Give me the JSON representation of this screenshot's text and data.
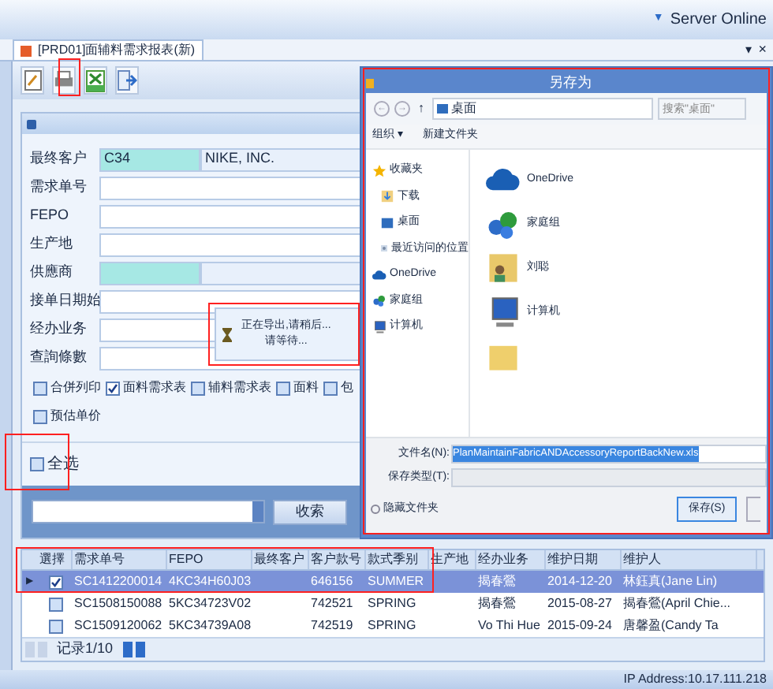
{
  "top_bar": {
    "menu_arrow": "▼",
    "status": "Server Online"
  },
  "tab": {
    "label": "[PRD01]面辅料需求报表(新)",
    "pin": "▾",
    "close": "×"
  },
  "toolbar": [
    {
      "kind": "edit"
    },
    {
      "kind": "print"
    },
    {
      "kind": "excel"
    },
    {
      "kind": "exit"
    }
  ],
  "form": {
    "fields": [
      {
        "label": "最终客户",
        "kind": "lookup",
        "value": "C34",
        "value_2": "NIKE, INC."
      },
      {
        "label": "需求单号",
        "kind": "text"
      },
      {
        "label": "FEPO",
        "kind": "text"
      },
      {
        "label": "生产地",
        "kind": "text"
      },
      {
        "label": "供應商",
        "kind": "lookup"
      },
      {
        "label": "接单日期始",
        "kind": "text"
      },
      {
        "label": "经办业务",
        "kind": "text"
      },
      {
        "label": "查詢條數",
        "kind": "text"
      }
    ],
    "checkboxes": [
      {
        "label": "合併列印",
        "checked": false
      },
      {
        "label": "面料需求表",
        "checked": true
      },
      {
        "label": "辅料需求表",
        "checked": false
      },
      {
        "label": "面料",
        "checked": false
      },
      {
        "label": "包",
        "checked": false
      },
      {
        "label": "预估单价",
        "checked": false
      }
    ],
    "select_all": {
      "label": "全选",
      "checked": false
    }
  },
  "search": {
    "button": "收索"
  },
  "grid": {
    "row_pointer": "▶",
    "check_header": "選擇",
    "columns": [
      "需求单号",
      "FEPO",
      "最终客户",
      "客户款号",
      "款式季别",
      "生产地",
      "经办业务",
      "维护日期",
      "维护人"
    ],
    "rows": [
      {
        "selected": true,
        "checked": true,
        "cells": [
          "SC1412200014",
          "4KC34H60J03",
          "",
          "646156",
          "SUMMER",
          "",
          "揭春鶯",
          "2014-12-20",
          "林鈺真(Jane Lin)"
        ]
      },
      {
        "selected": false,
        "checked": false,
        "cells": [
          "SC1508150088",
          "5KC34723V02",
          "",
          "742521",
          "SPRING",
          "",
          "揭春鶯",
          "2015-08-27",
          "揭春鶯(April Chie..."
        ]
      },
      {
        "selected": false,
        "checked": false,
        "cells": [
          "SC1509120062",
          "5KC34739A08",
          "",
          "742519",
          "SPRING",
          "",
          "Vo Thi Hue",
          "2015-09-24",
          "唐馨盈(Candy Ta"
        ]
      }
    ]
  },
  "pager": {
    "label": "记录1/10"
  },
  "status_bar": {
    "ip": "IP Address:10.17.111.218"
  },
  "export_popup": {
    "lines": [
      "正在导出,请稍后...",
      "请等待..."
    ]
  },
  "dialog": {
    "title": "另存为",
    "nav": [
      "←",
      "→",
      "↑"
    ],
    "path": "桌面",
    "search_placeholder": "搜索\"桌面\"",
    "menu": [
      "组织 ▾",
      "新建文件夹"
    ],
    "tree": [
      {
        "label": "收藏夹",
        "kind": "star"
      },
      {
        "label": "下载",
        "kind": "download"
      },
      {
        "label": "桌面",
        "kind": "desktop"
      },
      {
        "label": "最近访问的位置",
        "kind": "recent"
      },
      {
        "label": "OneDrive",
        "kind": "cloud"
      },
      {
        "label": "家庭组",
        "kind": "group"
      },
      {
        "label": "计算机",
        "kind": "computer"
      }
    ],
    "items": [
      {
        "label": "OneDrive",
        "kind": "cloud"
      },
      {
        "label": "家庭组",
        "kind": "group"
      },
      {
        "label": "刘聪",
        "kind": "user"
      },
      {
        "label": "计算机",
        "kind": "computer"
      },
      {
        "kind": "folder"
      }
    ],
    "filename_label": "文件名(N):",
    "filename": "PlanMaintainFabricANDAccessoryReportBackNew.xls",
    "type_label": "保存类型(T):",
    "hide_folders": "隐藏文件夹",
    "save": "保存(S)"
  }
}
